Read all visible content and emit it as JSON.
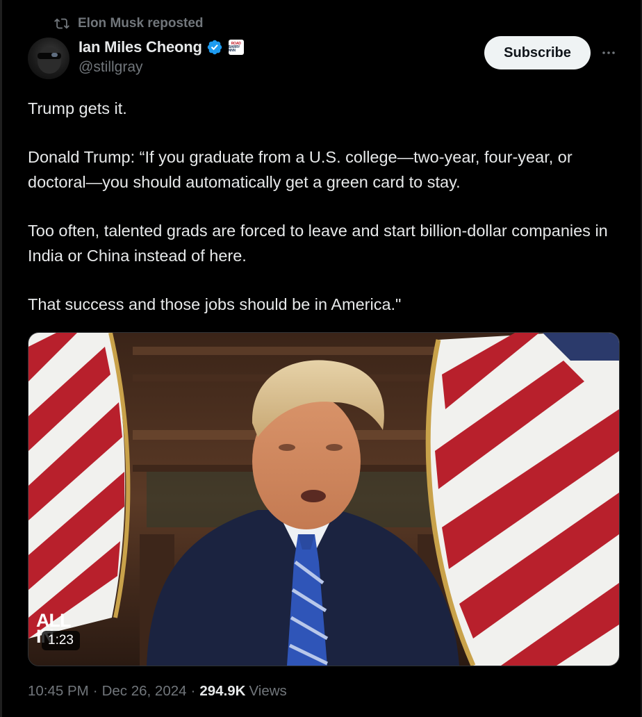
{
  "repost": {
    "label": "Elon Musk reposted",
    "icon": "repost-icon"
  },
  "author": {
    "display_name": "Ian Miles Cheong",
    "handle": "@stillgray",
    "verified_icon": "verified-badge-icon",
    "affiliate_icon": "affiliate-badge-icon",
    "affiliate_text_1": "ROAD",
    "affiliate_text_2": "BARRY NNN"
  },
  "actions": {
    "subscribe_label": "Subscribe",
    "more_icon": "more-icon"
  },
  "tweet": {
    "para1": "Trump gets it.",
    "para2": "Donald Trump: “If you graduate from a U.S. college—two-year, four-year, or doctoral—you should automatically get a green card to stay.",
    "para3": "Too often, talented grads are forced to leave and start billion-dollar companies in India or China instead of here.",
    "para4": "That success and those jobs should be in America.\""
  },
  "media": {
    "duration": "1:23",
    "watermark_line1": "ALL",
    "watermark_line2": "IN"
  },
  "meta": {
    "time": "10:45 PM",
    "date": "Dec 26, 2024",
    "views_count": "294.9K",
    "views_label": "Views"
  },
  "colors": {
    "background": "#000000",
    "text": "#e7e9ea",
    "muted": "#71767b",
    "verified": "#1d9bf0"
  }
}
